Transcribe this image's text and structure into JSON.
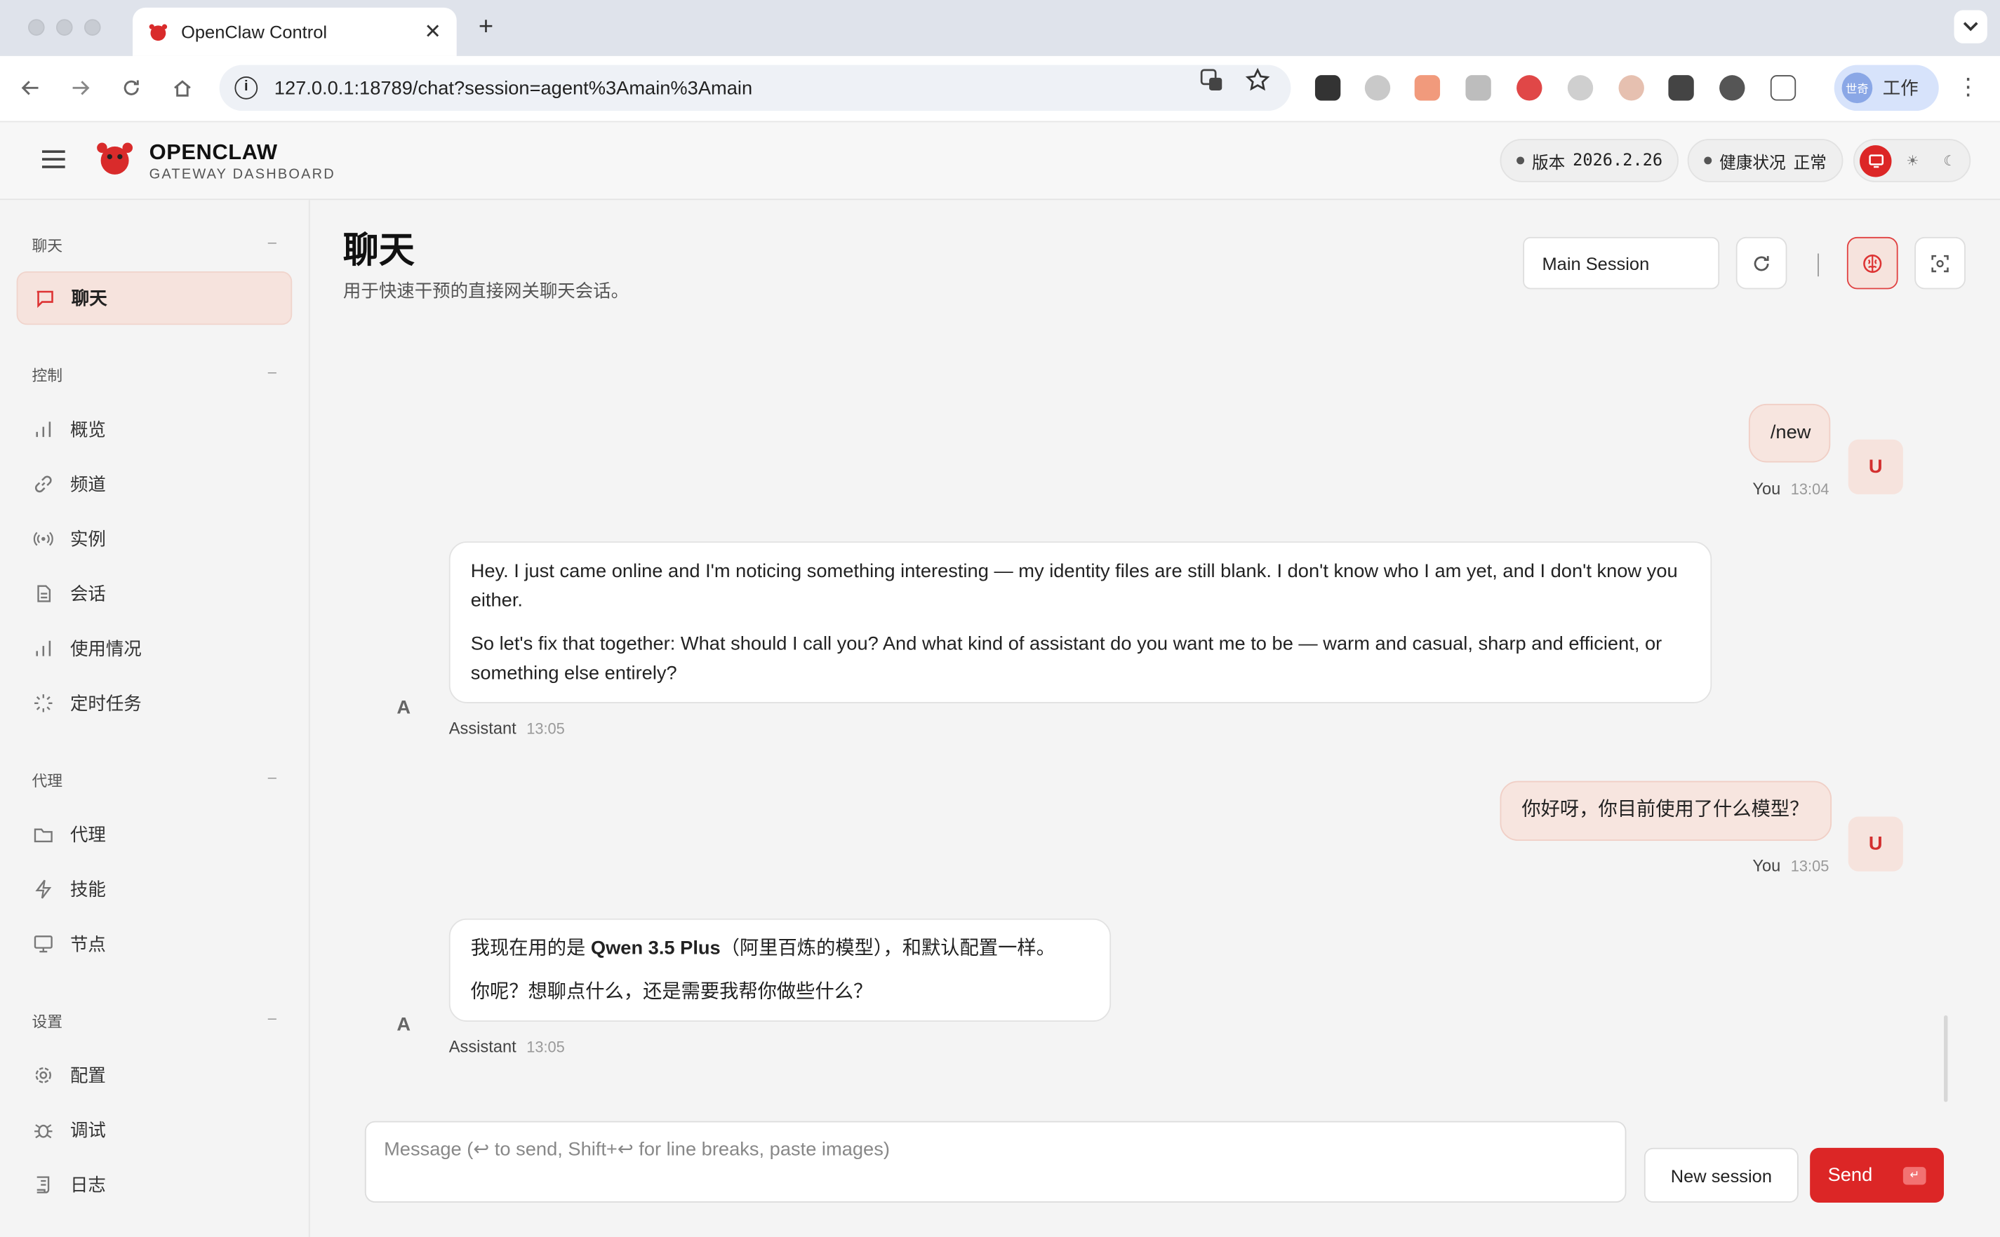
{
  "browser": {
    "tab_title": "OpenClaw Control",
    "tab_close": "✕",
    "new_tab": "+",
    "url": "127.0.0.1:18789/chat?session=agent%3Amain%3Amain",
    "profile_avatar_text": "世奇",
    "profile_label": "工作"
  },
  "header": {
    "brand_title": "OPENCLAW",
    "brand_subtitle": "GATEWAY DASHBOARD",
    "version_label": "版本",
    "version_value": "2026.2.26",
    "health_label": "健康状况",
    "health_value": "正常"
  },
  "sidebar": {
    "sections": [
      {
        "title": "聊天",
        "collapse": "–",
        "items": [
          {
            "label": "聊天",
            "icon": "message-icon",
            "active": true
          }
        ]
      },
      {
        "title": "控制",
        "collapse": "–",
        "items": [
          {
            "label": "概览",
            "icon": "bar-chart-icon"
          },
          {
            "label": "频道",
            "icon": "link-icon"
          },
          {
            "label": "实例",
            "icon": "radio-icon"
          },
          {
            "label": "会话",
            "icon": "document-icon"
          },
          {
            "label": "使用情况",
            "icon": "bar-chart-icon"
          },
          {
            "label": "定时任务",
            "icon": "loader-icon"
          }
        ]
      },
      {
        "title": "代理",
        "collapse": "–",
        "items": [
          {
            "label": "代理",
            "icon": "folder-icon"
          },
          {
            "label": "技能",
            "icon": "lightning-icon"
          },
          {
            "label": "节点",
            "icon": "monitor-icon"
          }
        ]
      },
      {
        "title": "设置",
        "collapse": "–",
        "items": [
          {
            "label": "配置",
            "icon": "gear-icon"
          },
          {
            "label": "调试",
            "icon": "bug-icon"
          },
          {
            "label": "日志",
            "icon": "scroll-icon"
          }
        ]
      }
    ]
  },
  "main": {
    "title": "聊天",
    "subtitle": "用于快速干预的直接网关聊天会话。",
    "session_select": "Main Session"
  },
  "messages": [
    {
      "role": "user",
      "avatar": "U",
      "author": "You",
      "time": "13:04",
      "text": "/new"
    },
    {
      "role": "assistant",
      "avatar": "A",
      "author": "Assistant",
      "time": "13:05",
      "p1": "Hey. I just came online and I'm noticing something interesting — my identity files are still blank. I don't know who I am yet, and I don't know you either.",
      "p2": "So let's fix that together: What should I call you? And what kind of assistant do you want me to be — warm and casual, sharp and efficient, or something else entirely?"
    },
    {
      "role": "user",
      "avatar": "U",
      "author": "You",
      "time": "13:05",
      "text": "你好呀，你目前使用了什么模型？"
    },
    {
      "role": "assistant",
      "avatar": "A",
      "author": "Assistant",
      "time": "13:05",
      "p1_pre": "我现在用的是 ",
      "p1_bold": "Qwen 3.5 Plus",
      "p1_post": "（阿里百炼的模型），和默认配置一样。",
      "p2": "你呢？想聊点什么，还是需要我帮你做些什么？"
    }
  ],
  "composer": {
    "placeholder": "Message (↩ to send, Shift+↩ for line breaks, paste images)",
    "new_session": "New session",
    "send": "Send",
    "send_key": "↵"
  },
  "colors": {
    "accent": "#dc2626",
    "user_bubble": "#f7e5df",
    "active_nav": "#f6e3dd"
  }
}
